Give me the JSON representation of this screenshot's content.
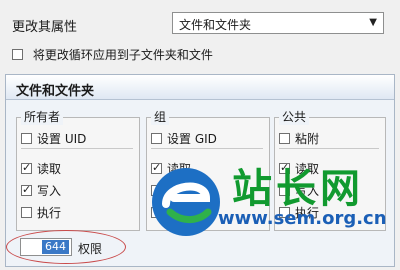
{
  "change_props": {
    "label": "更改其属性",
    "selected": "文件和文件夹"
  },
  "recursive": {
    "label": "将更改循环应用到子文件夹和文件",
    "checked": false
  },
  "section": {
    "title": "文件和文件夹",
    "groups": [
      {
        "title": "所有者",
        "special": {
          "label": "设置 UID",
          "checked": false
        },
        "perms": [
          {
            "label": "读取",
            "checked": true
          },
          {
            "label": "写入",
            "checked": true
          },
          {
            "label": "执行",
            "checked": false
          }
        ]
      },
      {
        "title": "组",
        "special": {
          "label": "设置 GID",
          "checked": false
        },
        "perms": [
          {
            "label": "读取",
            "checked": true
          },
          {
            "label": "写入",
            "checked": false
          },
          {
            "label": "执行",
            "checked": false
          }
        ]
      },
      {
        "title": "公共",
        "special": {
          "label": "粘附",
          "checked": false
        },
        "perms": [
          {
            "label": "读取",
            "checked": true
          },
          {
            "label": "写入",
            "checked": false
          },
          {
            "label": "执行",
            "checked": false
          }
        ]
      }
    ]
  },
  "permission": {
    "value": "644",
    "label": "权限"
  },
  "watermark": {
    "text": "站长网",
    "url": "www.sem.org.cn"
  }
}
